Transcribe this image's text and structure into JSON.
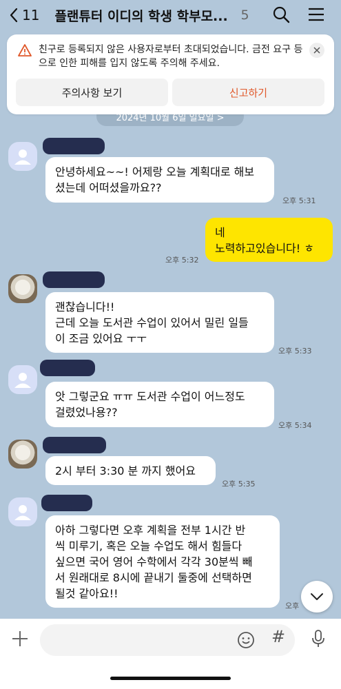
{
  "header": {
    "back_count": "11",
    "title": "플랜튜터 이디의 학생 학부모...",
    "member_count": "5"
  },
  "warning": {
    "text": "친구로 등록되지 않은 사용자로부터 초대되었습니다. 금전 요구 등으로 인한 피해를 입지 않도록 주의해 주세요.",
    "view_button": "주의사항 보기",
    "report_button": "신고하기"
  },
  "date_divider": "2024년 10월 6일 일요일 >",
  "messages": [
    {
      "from": "other",
      "text": "안녕하세요~~! 어제랑 오늘 계획대로 해보\n셨는데 어떠셨을까요??",
      "time": "오후 5:31"
    },
    {
      "from": "me",
      "text": "네\n노력하고있습니다! ㅎ",
      "time": "오후 5:32"
    },
    {
      "from": "other",
      "text": "괜찮습니다!!\n근데 오늘 도서관 수업이 있어서 밀린 일들\n이 조금 있어요 ㅜㅜ",
      "time": "오후 5:33"
    },
    {
      "from": "other",
      "text": "앗 그렇군요 ㅠㅠ 도서관 수업이 어느정도\n걸렸었나용??",
      "time": "오후 5:34"
    },
    {
      "from": "other",
      "text": "2시 부터 3:30 분 까지 했어요",
      "time": "오후 5:35"
    },
    {
      "from": "other",
      "text": "아하 그렇다면 오후 계획을 전부 1시간 반\n씩 미루기, 혹은 오늘 수업도 해서 힘들다\n싶으면 국어 영어 수학에서 각각 30분씩 빼\n서 원래대로 8시에 끝내기 둘중에 선택하면\n될것 같아요!!",
      "time": "오후"
    }
  ],
  "colors": {
    "background": "#b2c7da",
    "my_bubble": "#fee500",
    "report_accent": "#e0582a"
  },
  "icons": [
    "back-chevron-icon",
    "search-icon",
    "menu-icon",
    "warning-icon",
    "close-icon",
    "person-icon",
    "chevron-down-icon",
    "plus-icon",
    "emoji-icon",
    "hash-icon",
    "mic-icon"
  ]
}
